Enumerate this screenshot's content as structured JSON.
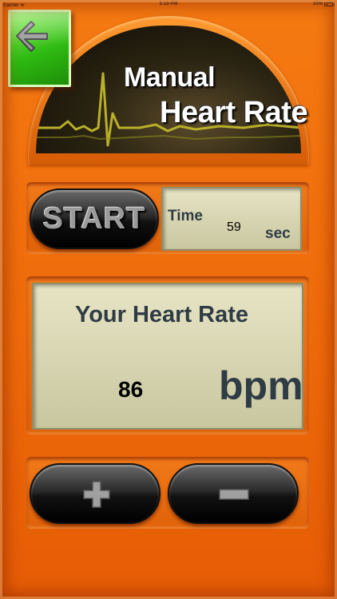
{
  "status_bar": {
    "carrier": "Carrier ᯤ",
    "time": "5:19 PM",
    "battery": "33%"
  },
  "header": {
    "title_line1": "Manual",
    "title_line2": "Heart Rate"
  },
  "timer": {
    "start_label": "START",
    "time_label": "Time",
    "time_value": "59",
    "time_unit": "sec"
  },
  "heart_rate": {
    "label": "Your Heart Rate",
    "value": "86",
    "unit": "bpm"
  },
  "icons": {
    "back": "arrow-left-icon",
    "plus": "plus-icon",
    "minus": "minus-icon"
  },
  "colors": {
    "background": "#f07010",
    "back_button": "#2fbb12",
    "lcd": "#d8d6b2",
    "label_text": "#2f3b45"
  }
}
